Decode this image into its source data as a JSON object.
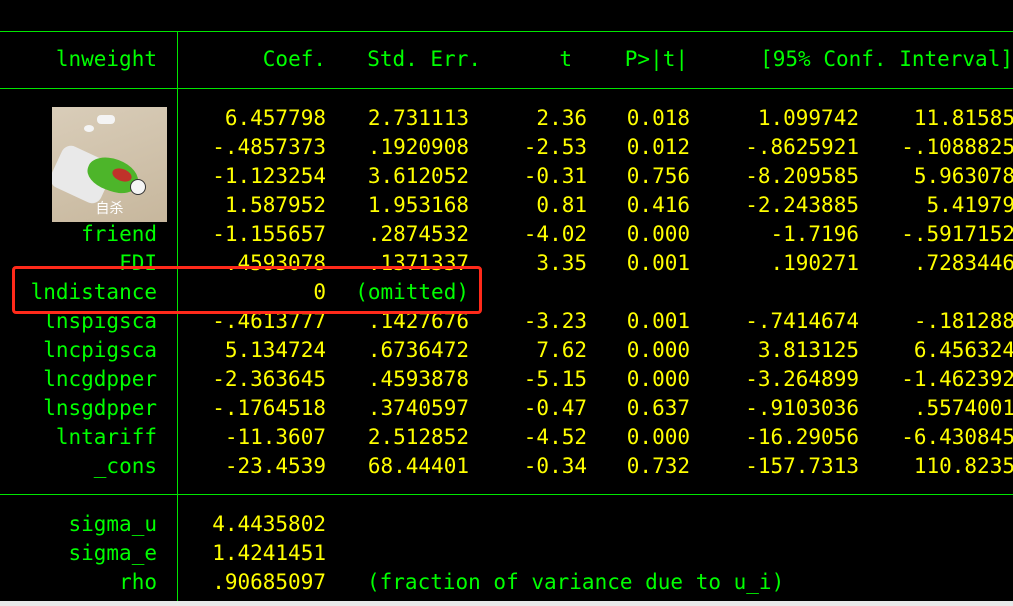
{
  "header": {
    "depvar": "lnweight",
    "coef": "Coef.",
    "se": "Std. Err.",
    "t": "t",
    "p": "P>|t|",
    "ci": "[95% Conf. Interval]"
  },
  "rows": [
    {
      "label": "",
      "coef": "6.457798",
      "se": "2.731113",
      "t": "2.36",
      "p": "0.018",
      "lo": "1.099742",
      "hi": "11.81585"
    },
    {
      "label": "",
      "coef": "-.4857373",
      "se": ".1920908",
      "t": "-2.53",
      "p": "0.012",
      "lo": "-.8625921",
      "hi": "-.1088825"
    },
    {
      "label": "",
      "coef": "-1.123254",
      "se": "3.612052",
      "t": "-0.31",
      "p": "0.756",
      "lo": "-8.209585",
      "hi": "5.963078"
    },
    {
      "label": "",
      "coef": "1.587952",
      "se": "1.953168",
      "t": "0.81",
      "p": "0.416",
      "lo": "-2.243885",
      "hi": "5.41979"
    },
    {
      "label": "friend",
      "coef": "-1.155657",
      "se": ".2874532",
      "t": "-4.02",
      "p": "0.000",
      "lo": "-1.7196",
      "hi": "-.5917152"
    },
    {
      "label": "FDI",
      "coef": ".4593078",
      "se": ".1371337",
      "t": "3.35",
      "p": "0.001",
      "lo": ".190271",
      "hi": ".7283446"
    },
    {
      "label": "lndistance",
      "coef": "0",
      "se": "(omitted)",
      "t": "",
      "p": "",
      "lo": "",
      "hi": "",
      "omitted": true
    },
    {
      "label": "lnspigsca",
      "coef": "-.4613777",
      "se": ".1427676",
      "t": "-3.23",
      "p": "0.001",
      "lo": "-.7414674",
      "hi": "-.181288"
    },
    {
      "label": "lncpigsca",
      "coef": "5.134724",
      "se": ".6736472",
      "t": "7.62",
      "p": "0.000",
      "lo": "3.813125",
      "hi": "6.456324"
    },
    {
      "label": "lncgdpper",
      "coef": "-2.363645",
      "se": ".4593878",
      "t": "-5.15",
      "p": "0.000",
      "lo": "-3.264899",
      "hi": "-1.462392"
    },
    {
      "label": "lnsgdpper",
      "coef": "-.1764518",
      "se": ".3740597",
      "t": "-0.47",
      "p": "0.637",
      "lo": "-.9103036",
      "hi": ".5574001"
    },
    {
      "label": "lntariff",
      "coef": "-11.3607",
      "se": "2.512852",
      "t": "-4.52",
      "p": "0.000",
      "lo": "-16.29056",
      "hi": "-6.430845"
    },
    {
      "label": "_cons",
      "coef": "-23.4539",
      "se": "68.44401",
      "t": "-0.34",
      "p": "0.732",
      "lo": "-157.7313",
      "hi": "110.8235"
    }
  ],
  "stats": [
    {
      "label": "sigma_u",
      "value": "4.4435802",
      "note": ""
    },
    {
      "label": "sigma_e",
      "value": "1.4241451",
      "note": ""
    },
    {
      "label": "rho",
      "value": ".90685097",
      "note": "(fraction of variance due to u_i)"
    }
  ],
  "overlay_image": {
    "caption": "自杀"
  },
  "colors": {
    "label": "#00ff00",
    "value": "#ffff00",
    "rule": "#00e600",
    "highlight": "#ff2a1a"
  }
}
